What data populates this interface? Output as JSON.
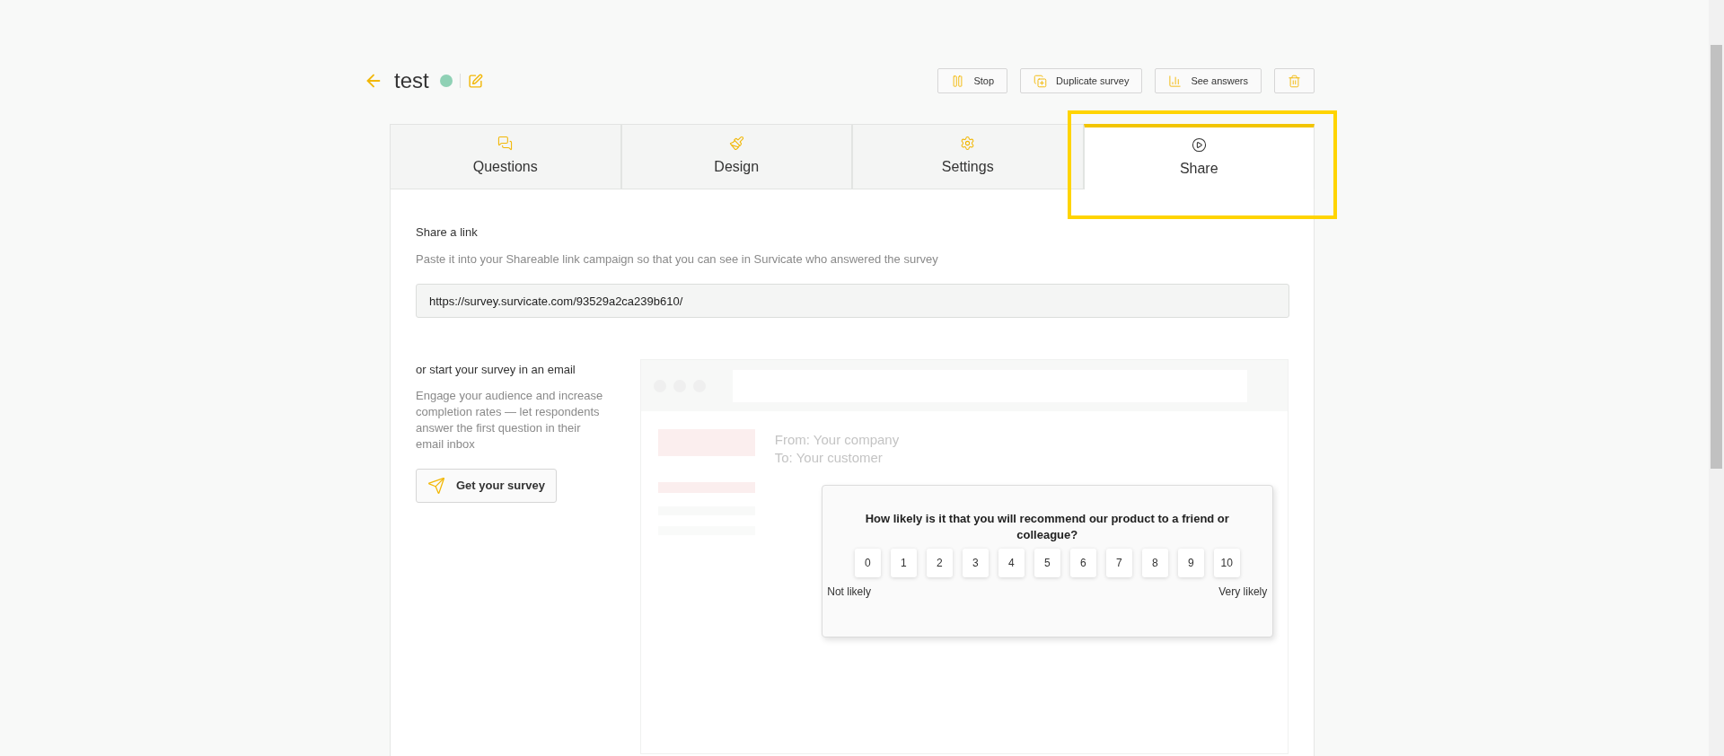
{
  "header": {
    "title": "test",
    "active": true,
    "actions": [
      {
        "kind": "stop",
        "label": "Stop"
      },
      {
        "kind": "duplicate",
        "label": "Duplicate survey"
      },
      {
        "kind": "answers",
        "label": "See answers"
      },
      {
        "kind": "delete"
      }
    ]
  },
  "tabs": [
    {
      "kind": "questions",
      "label": "Questions",
      "selected": false
    },
    {
      "kind": "design",
      "label": "Design",
      "selected": false
    },
    {
      "kind": "settings",
      "label": "Settings",
      "selected": false
    },
    {
      "kind": "share",
      "label": "Share",
      "selected": true
    }
  ],
  "share_link": {
    "title": "Share a link",
    "description": "Paste it into your Shareable link campaign so that you can see in Survicate who answered the survey",
    "url": "https://survey.survicate.com/93529a2ca239b610/"
  },
  "email": {
    "title": "or start your survey in an email",
    "description": "Engage your audience and increase completion rates — let respondents answer the first question in their email inbox",
    "button": "Get your survey",
    "preview": {
      "from": "From: Your company",
      "to": "To: Your customer",
      "question": "How likely is it that you will recommend our product to a friend or colleague?",
      "scale": [
        "0",
        "1",
        "2",
        "3",
        "4",
        "5",
        "6",
        "7",
        "8",
        "9",
        "10"
      ],
      "low_label": "Not likely",
      "high_label": "Very likely"
    }
  }
}
